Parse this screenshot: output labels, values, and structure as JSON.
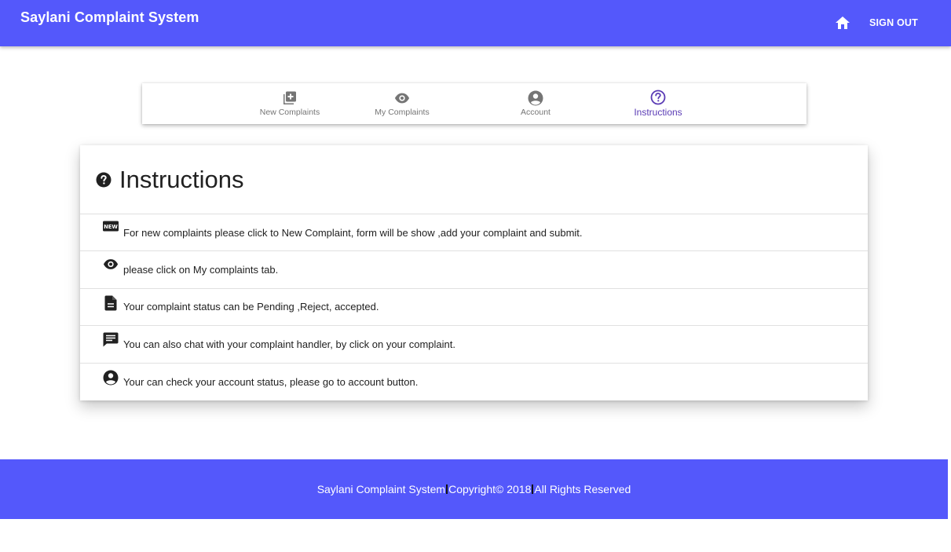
{
  "colors": {
    "primary": "#5458fb",
    "active_tab": "#5a3bb5",
    "icon_dark": "#212121",
    "inactive_tab": "#757575"
  },
  "appbar": {
    "title": "Saylani Complaint System",
    "home_icon": "home-icon",
    "signout_label": "SIGN OUT"
  },
  "tabs": [
    {
      "label": "New Complaints",
      "icon": "add-box-icon",
      "active": false
    },
    {
      "label": "My Complaints",
      "icon": "eye-icon",
      "active": false
    },
    {
      "label": "Account",
      "icon": "account-circle-icon",
      "active": false
    },
    {
      "label": "Instructions",
      "icon": "help-outline-icon",
      "active": true
    }
  ],
  "card": {
    "title": "Instructions",
    "title_icon": "question-circle-icon",
    "items": [
      {
        "icon": "new-badge-icon",
        "text": "For new complaints please click to New Complaint, form will be show ,add your complaint and submit."
      },
      {
        "icon": "eye-icon",
        "text": "please click on My complaints tab."
      },
      {
        "icon": "document-icon",
        "text": "Your complaint status can be Pending ,Reject, accepted."
      },
      {
        "icon": "chat-icon",
        "text": "You can also chat with your complaint handler, by click on your complaint."
      },
      {
        "icon": "account-circle-icon",
        "text": "Your can check your account status, please go to account button."
      }
    ]
  },
  "footer": {
    "part1": "Saylani Complaint System",
    "part2": "Copyright© 2018",
    "part3": "All Rights Reserved"
  }
}
